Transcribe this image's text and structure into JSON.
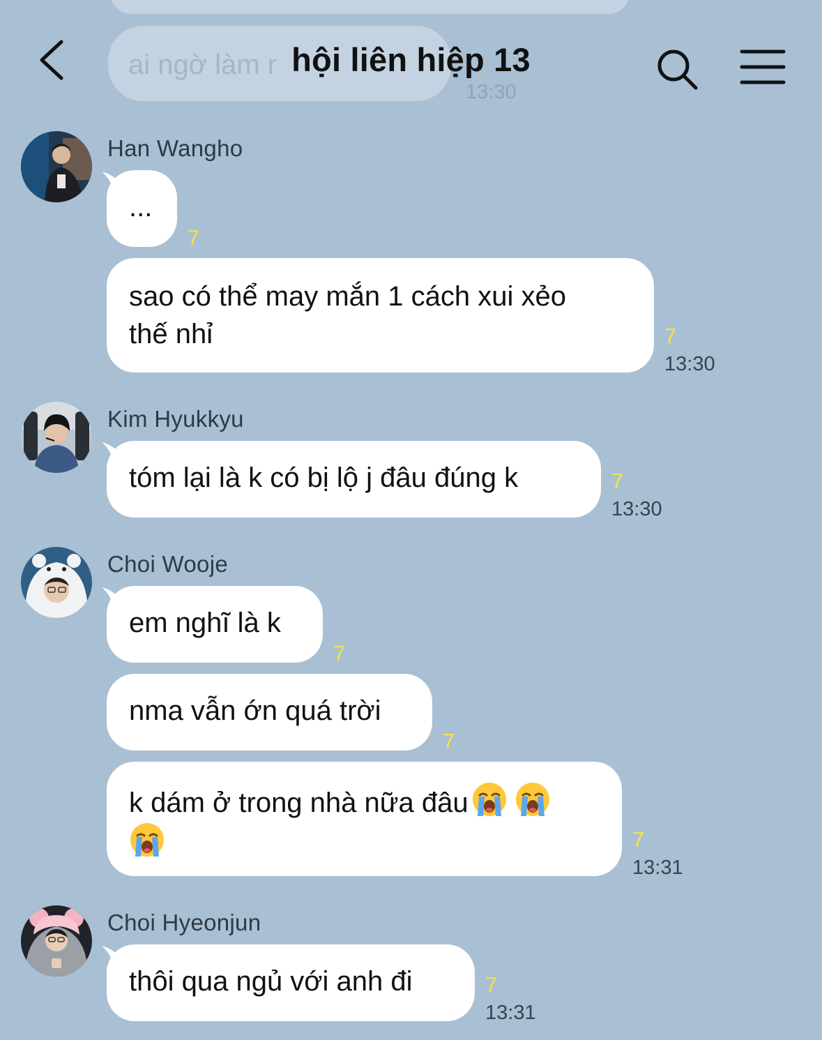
{
  "header": {
    "title": "hội liên hiệp 13"
  },
  "ghost": {
    "text": "ai ngờ làm ",
    "text_tail": "r",
    "time": "13:30"
  },
  "messages": [
    {
      "sender": "Han Wangho",
      "bubbles": [
        {
          "text": "...",
          "read": "7",
          "time": ""
        },
        {
          "line1": "sao có thể may mắn 1 cách xui xẻo",
          "line2": "thế nhỉ",
          "read": "7",
          "time": "13:30"
        }
      ]
    },
    {
      "sender": "Kim Hyukkyu",
      "bubbles": [
        {
          "text": "tóm lại là k có bị lộ j đâu đúng k",
          "read": "7",
          "time": "13:30"
        }
      ]
    },
    {
      "sender": "Choi Wooje",
      "bubbles": [
        {
          "text": "em nghĩ là k",
          "read": "7",
          "time": ""
        },
        {
          "text": "nma vẫn ớn quá trời",
          "read": "7",
          "time": ""
        },
        {
          "line1": "k dám ở trong nhà nữa đâu",
          "emoji": "loudly-crying-face",
          "read": "7",
          "time": "13:31"
        }
      ]
    },
    {
      "sender": "Choi Hyeonjun",
      "bubbles": [
        {
          "text": "thôi qua ngủ với anh đi",
          "read": "7",
          "time": "13:31"
        }
      ]
    }
  ],
  "colors": {
    "background": "#a9bfd3",
    "bubble": "#ffffff",
    "read_indicator": "#f4e24a"
  }
}
